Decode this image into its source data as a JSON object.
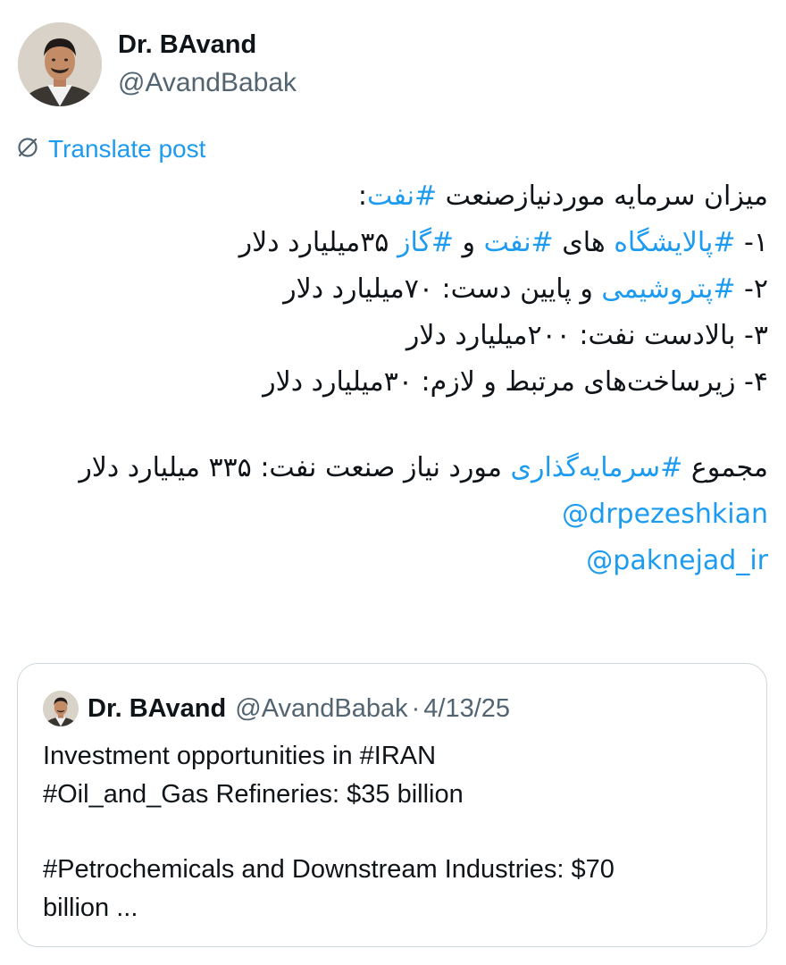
{
  "author": {
    "name": "Dr. BAvand",
    "handle": "@AvandBabak",
    "avatar": "profile-photo"
  },
  "translate": {
    "label": "Translate post",
    "icon": "translate-globe-icon"
  },
  "post": {
    "line1": {
      "text": "میزان سرمایه موردنیازصنعت ",
      "tag": "#نفت",
      "suffix": ":"
    },
    "line2": {
      "prefix": "۱- ",
      "tag1": "#پالایشگاه",
      "mid1": " های ",
      "tag2": "#نفت",
      "mid2": " و ",
      "tag3": "#گاز",
      "suffix": " ۳۵میلیارد دلار"
    },
    "line3": {
      "prefix": "۲- ",
      "tag": "#پتروشیمی",
      "suffix": " و پایین دست: ۷۰میلیارد دلار"
    },
    "line4": {
      "text": "۳- بالادست نفت: ۲۰۰میلیارد دلار"
    },
    "line5": {
      "text": "۴- زیرساخت‌های مرتبط و لازم: ۳۰میلیارد دلار"
    },
    "total": {
      "prefix": "مجموع ",
      "tag": "#سرمایه‌گذاری",
      "suffix": " مورد نیاز صنعت نفت: ۳۳۵ میلیارد دلار"
    },
    "mentions": [
      "@drpezeshkian",
      "@paknejad_ir"
    ]
  },
  "quote": {
    "name": "Dr. BAvand",
    "handle": "@AvandBabak",
    "separator": "·",
    "date": "4/13/25",
    "lines": [
      "Investment opportunities in #IRAN",
      "#Oil_and_Gas Refineries: $35 billion",
      "",
      "#Petrochemicals and Downstream Industries: $70",
      "billion  ..."
    ]
  },
  "colors": {
    "link": "#1d9bf0",
    "text": "#0f1419",
    "secondary": "#536471",
    "border": "#cfd9de"
  }
}
